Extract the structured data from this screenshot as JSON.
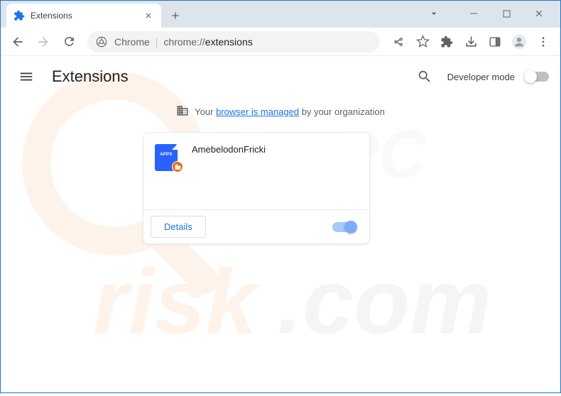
{
  "tab": {
    "title": "Extensions"
  },
  "omnibox": {
    "prefix": "Chrome",
    "url_gray": "chrome://",
    "url_strong": "extensions"
  },
  "page": {
    "title": "Extensions",
    "dev_mode_label": "Developer mode"
  },
  "managed": {
    "prefix": "Your ",
    "link": "browser is managed",
    "suffix": " by your organization"
  },
  "extension": {
    "name": "AmebelodonFricki",
    "details_label": "Details",
    "enabled": true
  }
}
